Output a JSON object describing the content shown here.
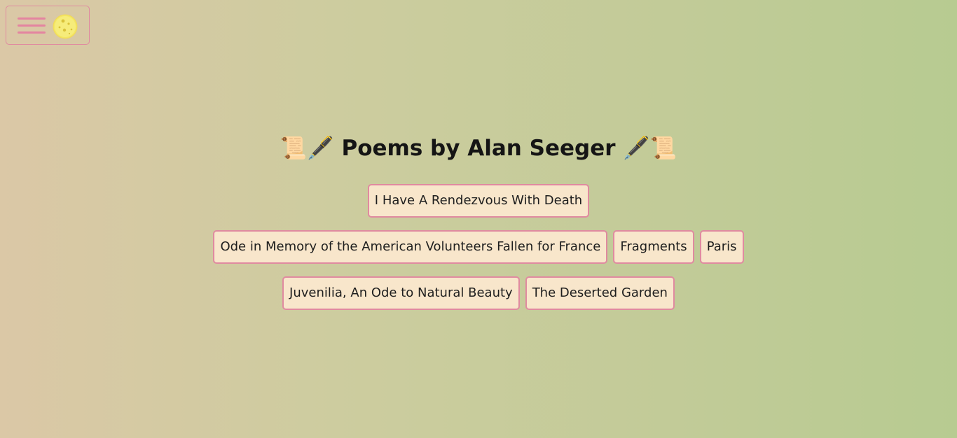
{
  "header": {
    "title": "Poems by Alan Seeger",
    "left_decoration": "📜🖋️",
    "right_decoration": "🖋️📜"
  },
  "toolbar": {
    "menu_icon": "hamburger-menu-icon",
    "theme_icon": "moon-icon"
  },
  "poems": [
    {
      "label": "I Have A Rendezvous With Death"
    },
    {
      "label": "Ode in Memory of the American Volunteers Fallen for France"
    },
    {
      "label": "Fragments"
    },
    {
      "label": "Paris"
    },
    {
      "label": "Juvenilia, An Ode to Natural Beauty"
    },
    {
      "label": "The Deserted Garden"
    }
  ],
  "colors": {
    "accent": "#e08aa0",
    "button_bg": "#f8e6cb",
    "moon": "#f3e661"
  }
}
